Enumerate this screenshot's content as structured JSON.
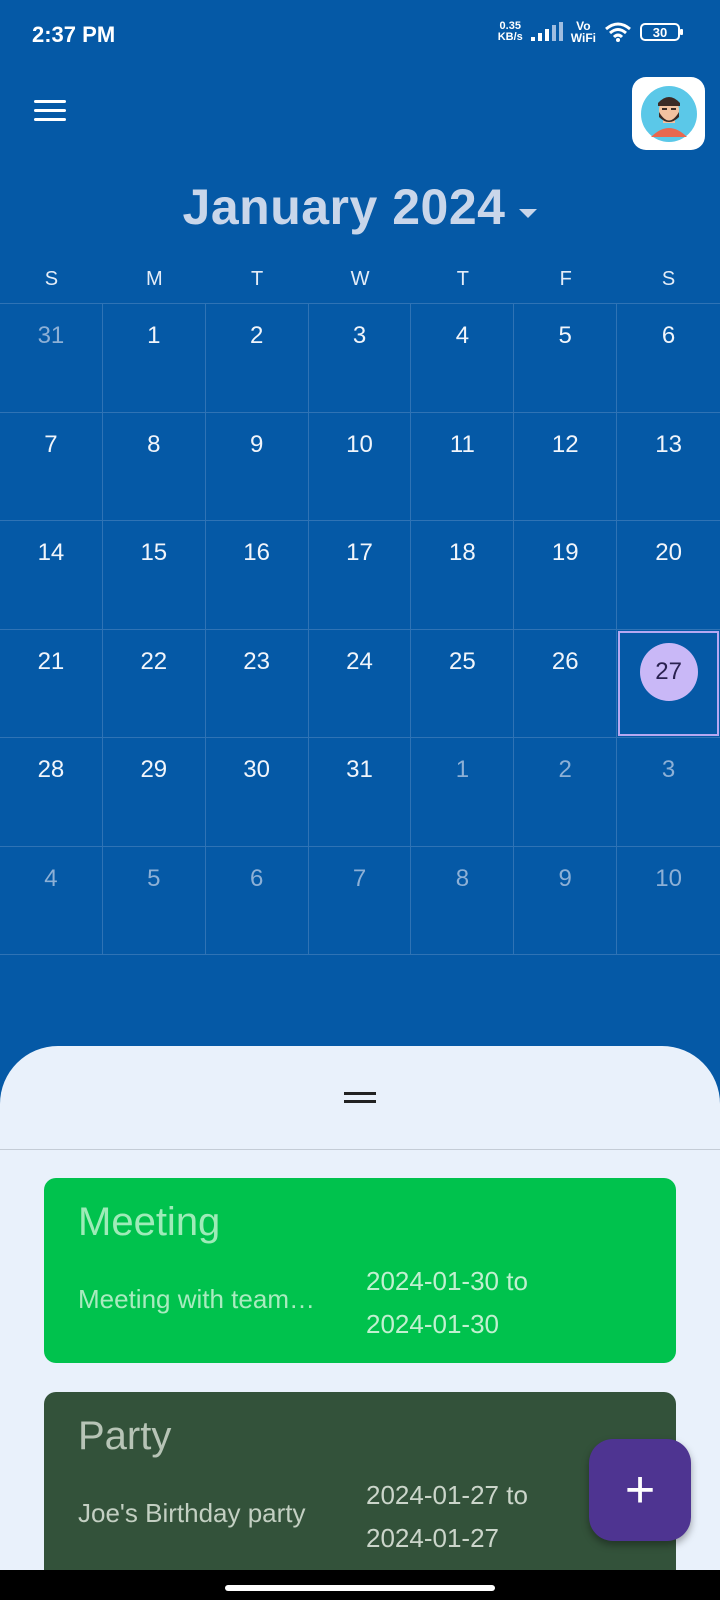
{
  "status_bar": {
    "time": "2:37 PM",
    "net_speed_value": "0.35",
    "net_speed_unit": "KB/s",
    "vowifi_top": "Vo",
    "vowifi_bottom": "WiFi",
    "battery": "30"
  },
  "header": {
    "menu_icon": "hamburger-menu-icon",
    "avatar_icon": "user-avatar-icon"
  },
  "calendar": {
    "month_label": "January 2024",
    "weekdays": [
      "S",
      "M",
      "T",
      "W",
      "T",
      "F",
      "S"
    ],
    "weeks": [
      [
        "31",
        "1",
        "2",
        "3",
        "4",
        "5",
        "6"
      ],
      [
        "7",
        "8",
        "9",
        "10",
        "11",
        "12",
        "13"
      ],
      [
        "14",
        "15",
        "16",
        "17",
        "18",
        "19",
        "20"
      ],
      [
        "21",
        "22",
        "23",
        "24",
        "25",
        "26",
        "27"
      ],
      [
        "28",
        "29",
        "30",
        "31",
        "1",
        "2",
        "3"
      ],
      [
        "4",
        "5",
        "6",
        "7",
        "8",
        "9",
        "10"
      ]
    ],
    "selected_day": "27"
  },
  "events": [
    {
      "title": "Meeting",
      "description": "Meeting with team…",
      "start": "2024-01-30 to",
      "end": "2024-01-30",
      "color": "#00C24D"
    },
    {
      "title": "Party",
      "description": "Joe's Birthday party",
      "start": "2024-01-27 to",
      "end": "2024-01-27",
      "color": "#33523A"
    }
  ],
  "fab": {
    "label": "+",
    "icon": "add-icon"
  },
  "colors": {
    "background": "#0559A6",
    "sheet": "#E9F1FB",
    "fab": "#4E3491",
    "selected_day": "#C9B8F7"
  }
}
